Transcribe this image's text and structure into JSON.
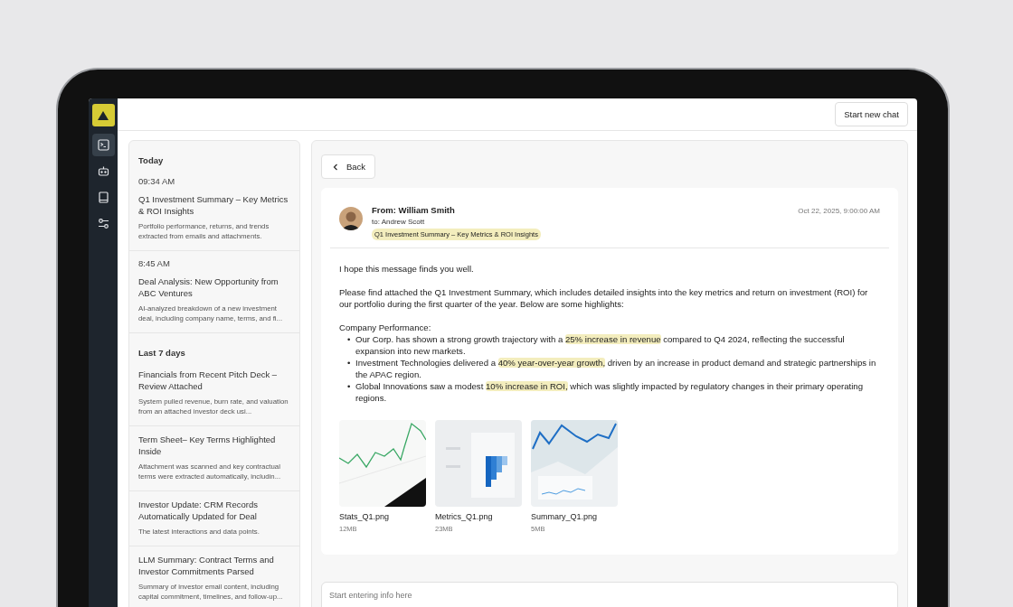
{
  "nav_items": [
    {
      "kind": "terminal",
      "selected": true
    },
    {
      "kind": "robot",
      "selected": false
    },
    {
      "kind": "book",
      "selected": false
    },
    {
      "kind": "sliders",
      "selected": false
    }
  ],
  "top_bar": {
    "button": "Start new chat"
  },
  "conversations": [
    {
      "heading": "Today",
      "items": [
        {
          "time": "09:34 AM",
          "title": "Q1 Investment Summary – Key Metrics & ROI Insights",
          "summary": "Portfolio performance, returns, and trends extracted from emails and attachments."
        },
        {
          "time": "8:45 AM",
          "title": "Deal Analysis: New Opportunity from ABC Ventures",
          "summary": "AI-analyzed breakdown of a new investment deal, including company name, terms, and fi..."
        }
      ]
    },
    {
      "heading": "Last 7 days",
      "items": [
        {
          "title": "Financials from Recent Pitch Deck – Review Attached",
          "summary": "System pulled revenue, burn rate, and valuation from an attached investor deck usi..."
        },
        {
          "title": "Term Sheet– Key Terms Highlighted Inside",
          "summary": "Attachment was scanned and key contractual terms were extracted automatically, includin..."
        },
        {
          "title": "Investor Update: CRM Records Automatically Updated for Deal",
          "summary": "The latest interactions and data points."
        },
        {
          "title": "LLM Summary: Contract Terms and Investor Commitments Parsed",
          "summary": "Summary of investor email content, including capital commitment, timelines, and follow-up..."
        }
      ]
    }
  ],
  "back_button": "Back",
  "email": {
    "from": "From: William Smith",
    "to": "to: Andrew Scott",
    "subject_tag": "Q1 Investment Summary – Key Metrics & ROI Insights",
    "date": "Oct 22, 2025, 9:00:00 AM",
    "paragraphs": [
      "I hope this message finds you well.",
      "Please find attached the Q1 Investment Summary, which includes detailed insights into the key metrics and return on investment (ROI) for our portfolio during the first quarter of the year. Below are some highlights:"
    ],
    "list_heading": "Company Performance:",
    "bullets": [
      {
        "marker": "•",
        "parts": [
          {
            "text": "Our Corp. has shown a strong growth trajectory with a ",
            "highlight": false
          },
          {
            "text": "25% increase in revenue",
            "highlight": true
          },
          {
            "text": " compared to Q4 2024, reflecting the successful expansion into new markets.",
            "highlight": false
          }
        ]
      },
      {
        "marker": "•",
        "parts": [
          {
            "text": "Investment Technologies delivered a ",
            "highlight": false
          },
          {
            "text": "40% year-over-year growth,",
            "highlight": true
          },
          {
            "text": " driven by an increase in product demand and strategic partnerships in the APAC region.",
            "highlight": false
          }
        ]
      },
      {
        "marker": "•",
        "parts": [
          {
            "text": "Global Innovations saw a modest ",
            "highlight": false
          },
          {
            "text": "10% increase in ROI,",
            "highlight": true
          },
          {
            "text": " which was slightly impacted by regulatory changes in their primary operating regions.",
            "highlight": false
          }
        ]
      }
    ],
    "attachments": [
      {
        "kind": "line-green",
        "name": "Stats_Q1.png",
        "size": "12MB"
      },
      {
        "kind": "grid-blue",
        "name": "Metrics_Q1.png",
        "size": "23MB"
      },
      {
        "kind": "line-blue",
        "name": "Summary_Q1.png",
        "size": "5MB"
      }
    ]
  },
  "input": {
    "placeholder": "Start entering info here"
  }
}
